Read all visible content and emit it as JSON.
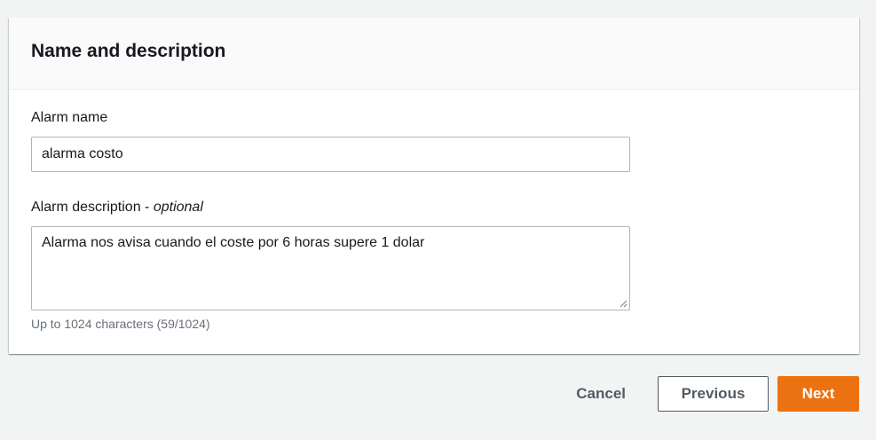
{
  "panel": {
    "title": "Name and description"
  },
  "alarm_name": {
    "label": "Alarm name",
    "value": "alarma costo"
  },
  "alarm_description": {
    "label": "Alarm description",
    "label_separator": " - ",
    "label_optional": "optional",
    "value": "Alarma nos avisa cuando el coste por 6 horas supere 1 dolar",
    "hint": "Up to 1024 characters (59/1024)"
  },
  "actions": {
    "cancel_label": "Cancel",
    "previous_label": "Previous",
    "next_label": "Next"
  },
  "colors": {
    "primary_button": "#ec7211",
    "page_background": "#f2f3f3"
  }
}
